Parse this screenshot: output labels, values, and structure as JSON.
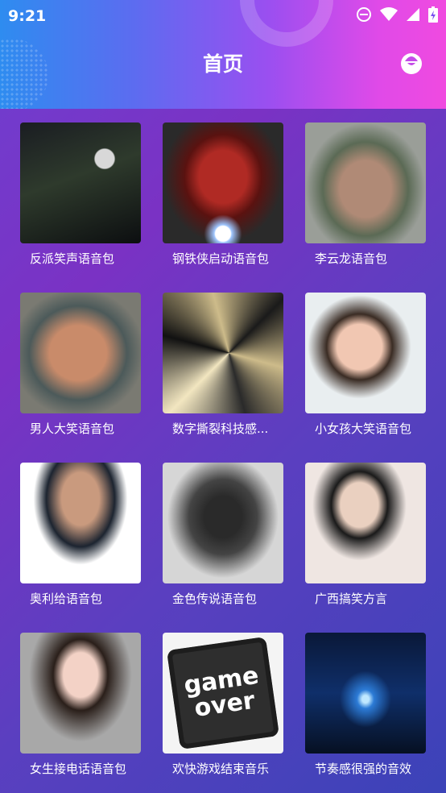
{
  "status_bar": {
    "time": "9:21",
    "icons": [
      "do-not-disturb-icon",
      "wifi-icon",
      "signal-icon",
      "battery-charging-icon"
    ]
  },
  "header": {
    "title": "首页",
    "profile_icon": "smiley-face-icon"
  },
  "colors": {
    "header_gradient_start": "#2e8cf0",
    "header_gradient_end": "#f04ae0",
    "background_top": "#6f3fd0",
    "background_bottom": "#3b43b8",
    "text": "#ffffff"
  },
  "voice_packs": [
    {
      "title": "反派笑声语音包",
      "image": "villain-cartoon-thumbnail"
    },
    {
      "title": "钢铁侠启动语音包",
      "image": "iron-man-thumbnail"
    },
    {
      "title": "李云龙语音包",
      "image": "li-yunlong-thumbnail"
    },
    {
      "title": "男人大笑语音包",
      "image": "laughing-man-thumbnail"
    },
    {
      "title": "数字撕裂科技感...",
      "image": "digital-tear-thumbnail"
    },
    {
      "title": "小女孩大笑语音包",
      "image": "laughing-girl-thumbnail"
    },
    {
      "title": "奥利给语音包",
      "image": "aoligei-thumbnail"
    },
    {
      "title": "金色传说语音包",
      "image": "golden-legend-thumbnail"
    },
    {
      "title": "广西搞笑方言",
      "image": "guangxi-dialect-thumbnail"
    },
    {
      "title": "女生接电话语音包",
      "image": "girl-phone-thumbnail"
    },
    {
      "title": "欢快游戏结束音乐",
      "image": "game-over-key-thumbnail",
      "overlay_text": [
        "game",
        "over"
      ]
    },
    {
      "title": "节奏感很强的音效",
      "image": "sound-wave-thumbnail"
    }
  ]
}
